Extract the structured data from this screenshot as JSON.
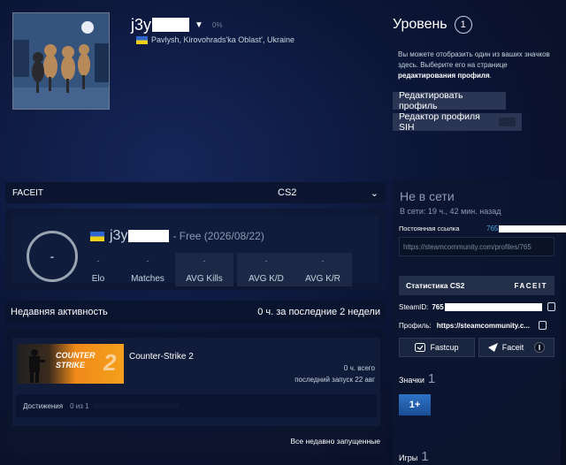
{
  "profile": {
    "name": "j3y",
    "completion": "0%",
    "location": "Pavlysh, Kirovohrads'ka Oblast', Ukraine"
  },
  "level": {
    "title": "Уровень",
    "value": "1",
    "text_lead": "Вы можете отобразить один из ваших значков здесь. Выберите его на странице ",
    "text_link": "редактирования профиля",
    "text_tail": "."
  },
  "buttons": {
    "edit_profile": "Редактировать профиль",
    "sih_editor": "Редактор профиля SIH"
  },
  "faceit": {
    "label": "FACEIT",
    "game": "CS2",
    "player_name": "j3y",
    "account": "- Free (2026/08/22)",
    "level_symbol": "-",
    "stats": [
      {
        "label": "Elo",
        "value": "-"
      },
      {
        "label": "Matches",
        "value": "-"
      },
      {
        "label": "AVG Kills",
        "value": "-"
      },
      {
        "label": "AVG K/D",
        "value": "-"
      },
      {
        "label": "AVG K/R",
        "value": "-"
      }
    ]
  },
  "recent": {
    "title": "Недавняя активность",
    "hours": "0 ч. за последние 2 недели",
    "game": {
      "art_line1": "COUNTER",
      "art_line2": "STRIKE",
      "art_num": "2",
      "title": "Counter-Strike 2",
      "total": "0 ч. всего",
      "last_launch": "последний запуск 22 авг"
    },
    "achievements_label": "Достижения",
    "achievements_count": "0 из 1",
    "all_link": "Все недавно запущенные"
  },
  "sidebar": {
    "status": "Не в сети",
    "last_online": "В сети: 19 ч., 42 мин. назад",
    "permalink_label": "Постоянная ссылка",
    "permalink_id": "765",
    "permalink_url": "https://steamcommunity.com/profiles/765",
    "cs2_stats": "Статистика CS2",
    "faceit_logo": "FACEIT",
    "steamid_label": "SteamID:",
    "steamid_value": "765",
    "profile_label": "Профиль:",
    "profile_value": "https://steamcommunity.c...",
    "fastcup": "Fastcup",
    "faceit_btn": "Faceit",
    "badges_label": "Значки",
    "badges_count": "1",
    "badge_tile": "1+",
    "games_label": "Игры",
    "games_count": "1"
  },
  "colors": {
    "accent_link": "#4a9fe0",
    "panel": "#101c3c",
    "button": "#2a3654"
  }
}
